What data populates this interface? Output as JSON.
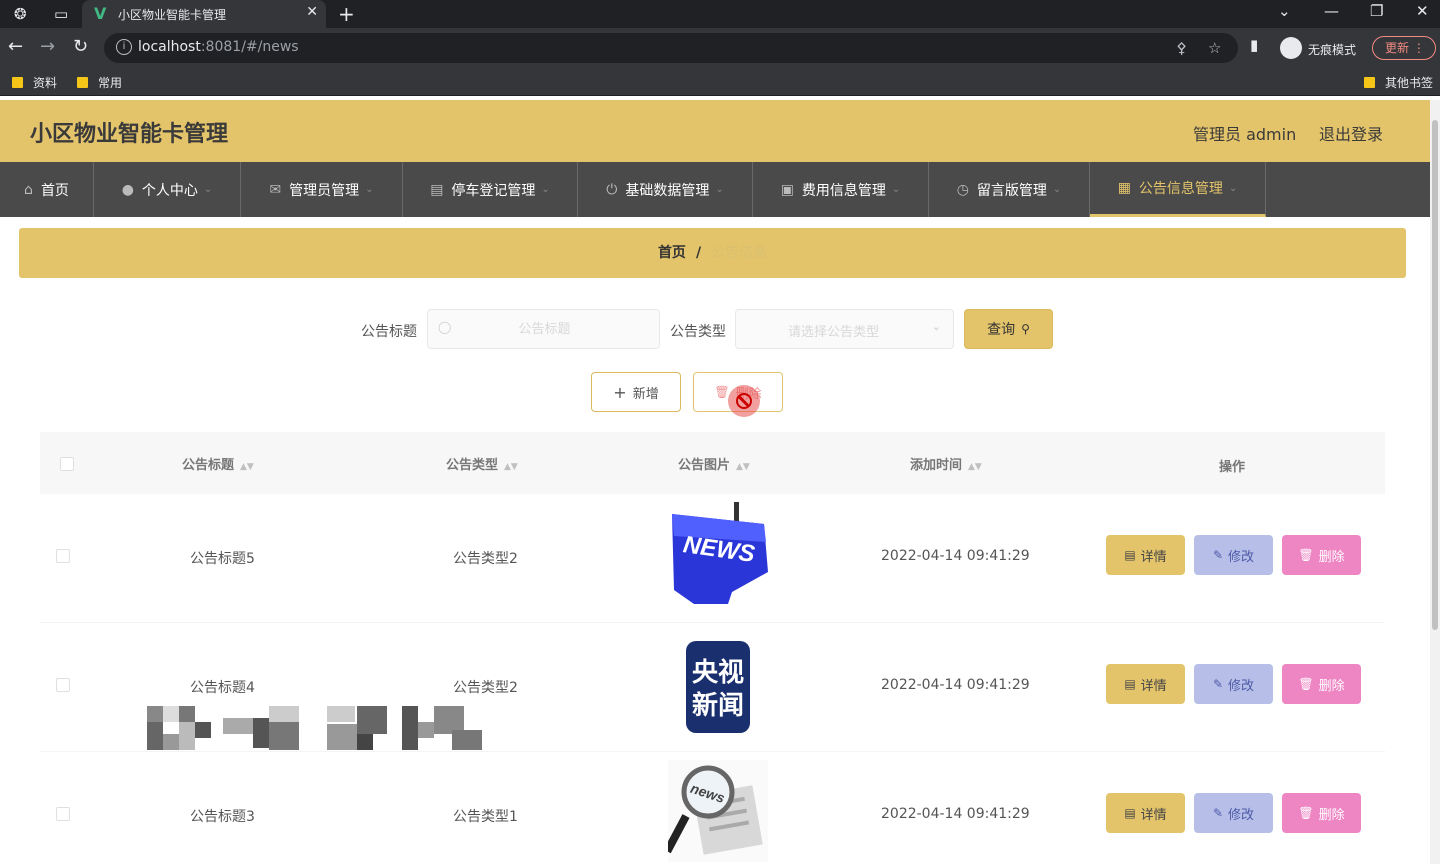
{
  "browser": {
    "tab_title": "小区物业智能卡管理",
    "url_host": "localhost",
    "url_rest": ":8081/#/news",
    "incognito_label": "无痕模式",
    "update_label": "更新",
    "bookmarks": [
      "资料",
      "常用"
    ],
    "other_bookmarks": "其他书签"
  },
  "header": {
    "title": "小区物业智能卡管理",
    "admin": "管理员 admin",
    "logout": "退出登录"
  },
  "nav": [
    {
      "label": "首页",
      "icon": "home-icon"
    },
    {
      "label": "个人中心",
      "icon": "user-icon"
    },
    {
      "label": "管理员管理",
      "icon": "mail-icon"
    },
    {
      "label": "停车登记管理",
      "icon": "briefcase-icon"
    },
    {
      "label": "基础数据管理",
      "icon": "power-icon"
    },
    {
      "label": "费用信息管理",
      "icon": "wallet-icon"
    },
    {
      "label": "留言版管理",
      "icon": "clock-icon"
    },
    {
      "label": "公告信息管理",
      "icon": "grid-icon",
      "active": true
    }
  ],
  "breadcrumb": {
    "home": "首页",
    "separator": "/",
    "current": "公告信息"
  },
  "search": {
    "title_label": "公告标题",
    "title_placeholder": "公告标题",
    "type_label": "公告类型",
    "type_placeholder": "请选择公告类型",
    "query_label": "查询"
  },
  "toolbar": {
    "add_label": "新增",
    "delete_label": "删除"
  },
  "table": {
    "headers": {
      "title": "公告标题",
      "type": "公告类型",
      "image": "公告图片",
      "time": "添加时间",
      "ops": "操作"
    },
    "rows": [
      {
        "title": "公告标题5",
        "type": "公告类型2",
        "image": "news-keyboard-image",
        "time": "2022-04-14 09:41:29"
      },
      {
        "title": "公告标题4",
        "type": "公告类型2",
        "image": "cctv-news-logo",
        "time": "2022-04-14 09:41:29"
      },
      {
        "title": "公告标题3",
        "type": "公告类型1",
        "image": "newspaper-magnifier-image",
        "time": "2022-04-14 09:41:29"
      }
    ],
    "actions": {
      "detail": "详情",
      "edit": "修改",
      "delete": "删除"
    },
    "cctv_logo_text": [
      "央视",
      "新闻"
    ]
  },
  "colors": {
    "accent": "#e4c46b",
    "nav_bg": "#4a4a4a",
    "edit": "#b7bfe8",
    "delete": "#ee86c4"
  }
}
